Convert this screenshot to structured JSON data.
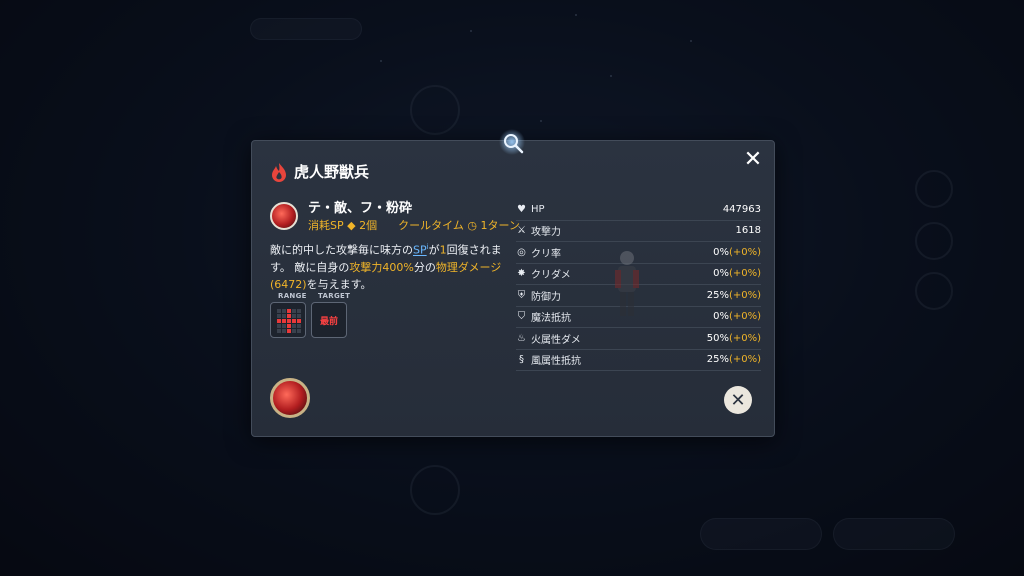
{
  "modal": {
    "title": "虎人野獣兵",
    "close_glyph": "✕",
    "skill": {
      "name": "テ・敵、フ・粉砕",
      "cost_label": "消耗SP",
      "cost_value": "2個",
      "cooldown_label": "クールタイム",
      "cooldown_value": "1ターン",
      "desc": {
        "p1": "敵に的中した攻撃毎に味方の",
        "sp": "SP",
        "sp_sup": "i",
        "p2": "が",
        "n1": "1",
        "p3": "回復されます。 敵に自身の",
        "atk": "攻撃力400%",
        "p4": "分の",
        "dmg": "物理ダメージ(6472)",
        "p5": "を与えます。"
      },
      "range_label": "RANGE",
      "target_label": "TARGET",
      "target_value": "最前",
      "range_grid": [
        [
          0,
          0,
          1,
          0,
          0
        ],
        [
          0,
          0,
          1,
          0,
          0
        ],
        [
          1,
          1,
          1,
          1,
          1
        ],
        [
          0,
          0,
          1,
          0,
          0
        ],
        [
          0,
          0,
          1,
          0,
          0
        ]
      ]
    },
    "stats": [
      {
        "icon": "heart-plus-icon",
        "name": "HP",
        "value": "447963",
        "bonus": ""
      },
      {
        "icon": "sword-icon",
        "name": "攻撃力",
        "value": "1618",
        "bonus": ""
      },
      {
        "icon": "crit-rate-icon",
        "name": "クリ率",
        "value": "0%",
        "bonus": "(+0%)"
      },
      {
        "icon": "crit-damage-icon",
        "name": "クリダメ",
        "value": "0%",
        "bonus": "(+0%)"
      },
      {
        "icon": "shield-icon",
        "name": "防御力",
        "value": "25%",
        "bonus": "(+0%)"
      },
      {
        "icon": "magic-shield-icon",
        "name": "魔法抵抗",
        "value": "0%",
        "bonus": "(+0%)"
      },
      {
        "icon": "fire-icon",
        "name": "火属性ダメ",
        "value": "50%",
        "bonus": "(+0%)"
      },
      {
        "icon": "wind-shield-icon",
        "name": "風属性抵抗",
        "value": "25%",
        "bonus": "(+0%)"
      }
    ],
    "dismiss_glyph": "✕"
  },
  "colors": {
    "accent": "#f0b429",
    "link": "#6ab8ff",
    "danger": "#e8393a",
    "panel": "#2b3340"
  }
}
